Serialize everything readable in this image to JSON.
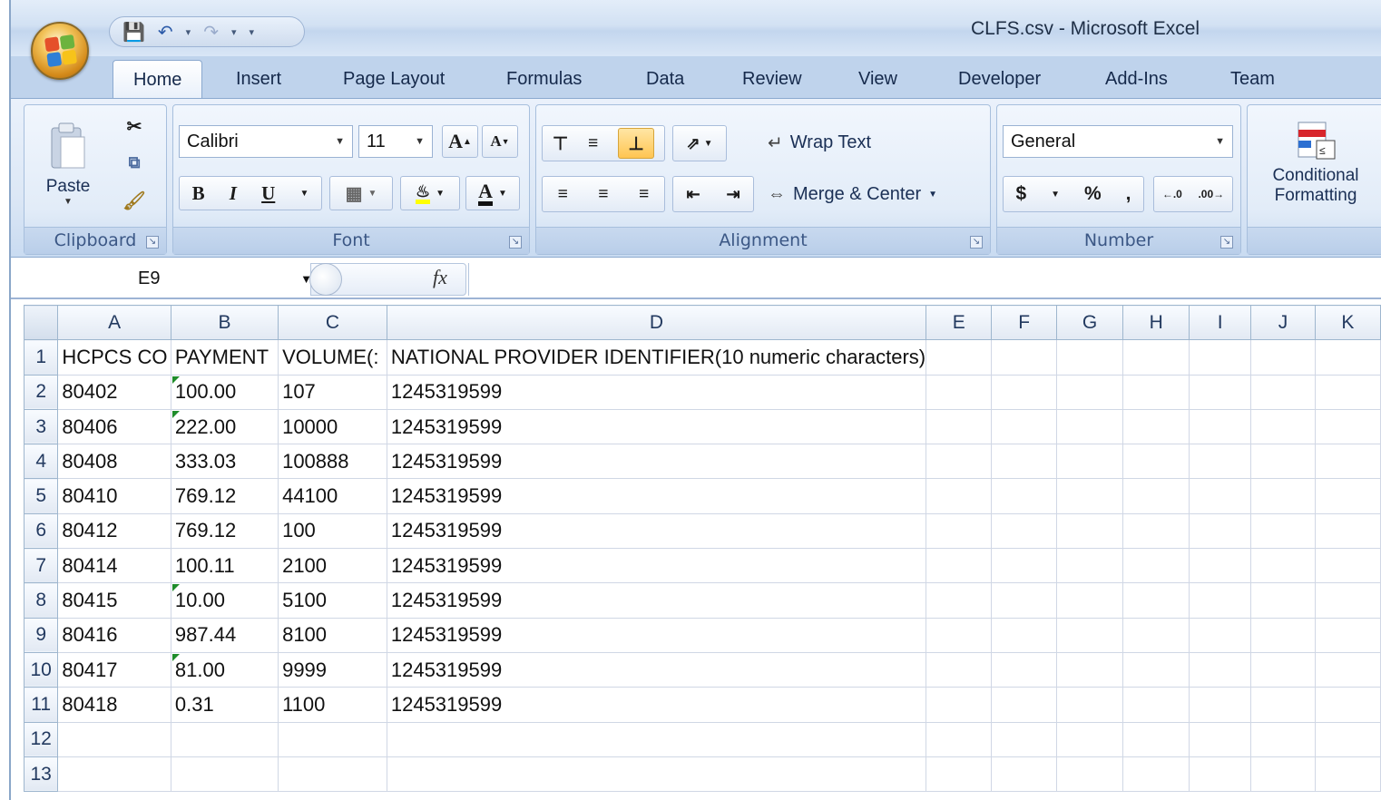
{
  "window": {
    "title": "CLFS.csv - Microsoft Excel"
  },
  "quick_access": {
    "icons": [
      "save-icon",
      "undo-icon",
      "redo-icon",
      "customize-icon"
    ]
  },
  "ribbon": {
    "tabs": [
      "Home",
      "Insert",
      "Page Layout",
      "Formulas",
      "Data",
      "Review",
      "View",
      "Developer",
      "Add-Ins",
      "Team"
    ],
    "active_tab": "Home",
    "clipboard": {
      "label": "Clipboard",
      "paste": "Paste"
    },
    "font": {
      "label": "Font",
      "font_name": "Calibri",
      "font_size": "11"
    },
    "alignment": {
      "label": "Alignment",
      "wrap_text": "Wrap Text",
      "merge_center": "Merge & Center"
    },
    "number": {
      "label": "Number",
      "format": "General",
      "currency": "$",
      "percent": "%",
      "comma": ","
    },
    "styles": {
      "conditional_1": "Conditional",
      "conditional_2": "Formatting"
    }
  },
  "formula_bar": {
    "name_box": "E9",
    "fx": "fx",
    "formula": ""
  },
  "sheet": {
    "columns": [
      "A",
      "B",
      "C",
      "D",
      "E",
      "F",
      "G",
      "H",
      "I",
      "J",
      "K"
    ],
    "row_numbers": [
      "1",
      "2",
      "3",
      "4",
      "5",
      "6",
      "7",
      "8",
      "9",
      "10",
      "11",
      "12",
      "13"
    ],
    "rows": [
      [
        "HCPCS CO",
        "PAYMENT",
        "VOLUME(:",
        "NATIONAL PROVIDER IDENTIFIER(10 numeric characters)"
      ],
      [
        "80402",
        "100.00",
        "107",
        "1245319599"
      ],
      [
        "80406",
        "222.00",
        "10000",
        "1245319599"
      ],
      [
        "80408",
        "333.03",
        "100888",
        "1245319599"
      ],
      [
        "80410",
        "769.12",
        "44100",
        "1245319599"
      ],
      [
        "80412",
        "769.12",
        "100",
        "1245319599"
      ],
      [
        "80414",
        "100.11",
        "2100",
        "1245319599"
      ],
      [
        "80415",
        "10.00",
        "5100",
        "1245319599"
      ],
      [
        "80416",
        "987.44",
        "8100",
        "1245319599"
      ],
      [
        "80417",
        "81.00",
        "9999",
        "1245319599"
      ],
      [
        "80418",
        "0.31",
        "1100",
        "1245319599"
      ],
      [
        "",
        "",
        "",
        ""
      ],
      [
        "",
        "",
        "",
        ""
      ]
    ],
    "error_indicator_rows": [
      2,
      3,
      8,
      10
    ]
  }
}
